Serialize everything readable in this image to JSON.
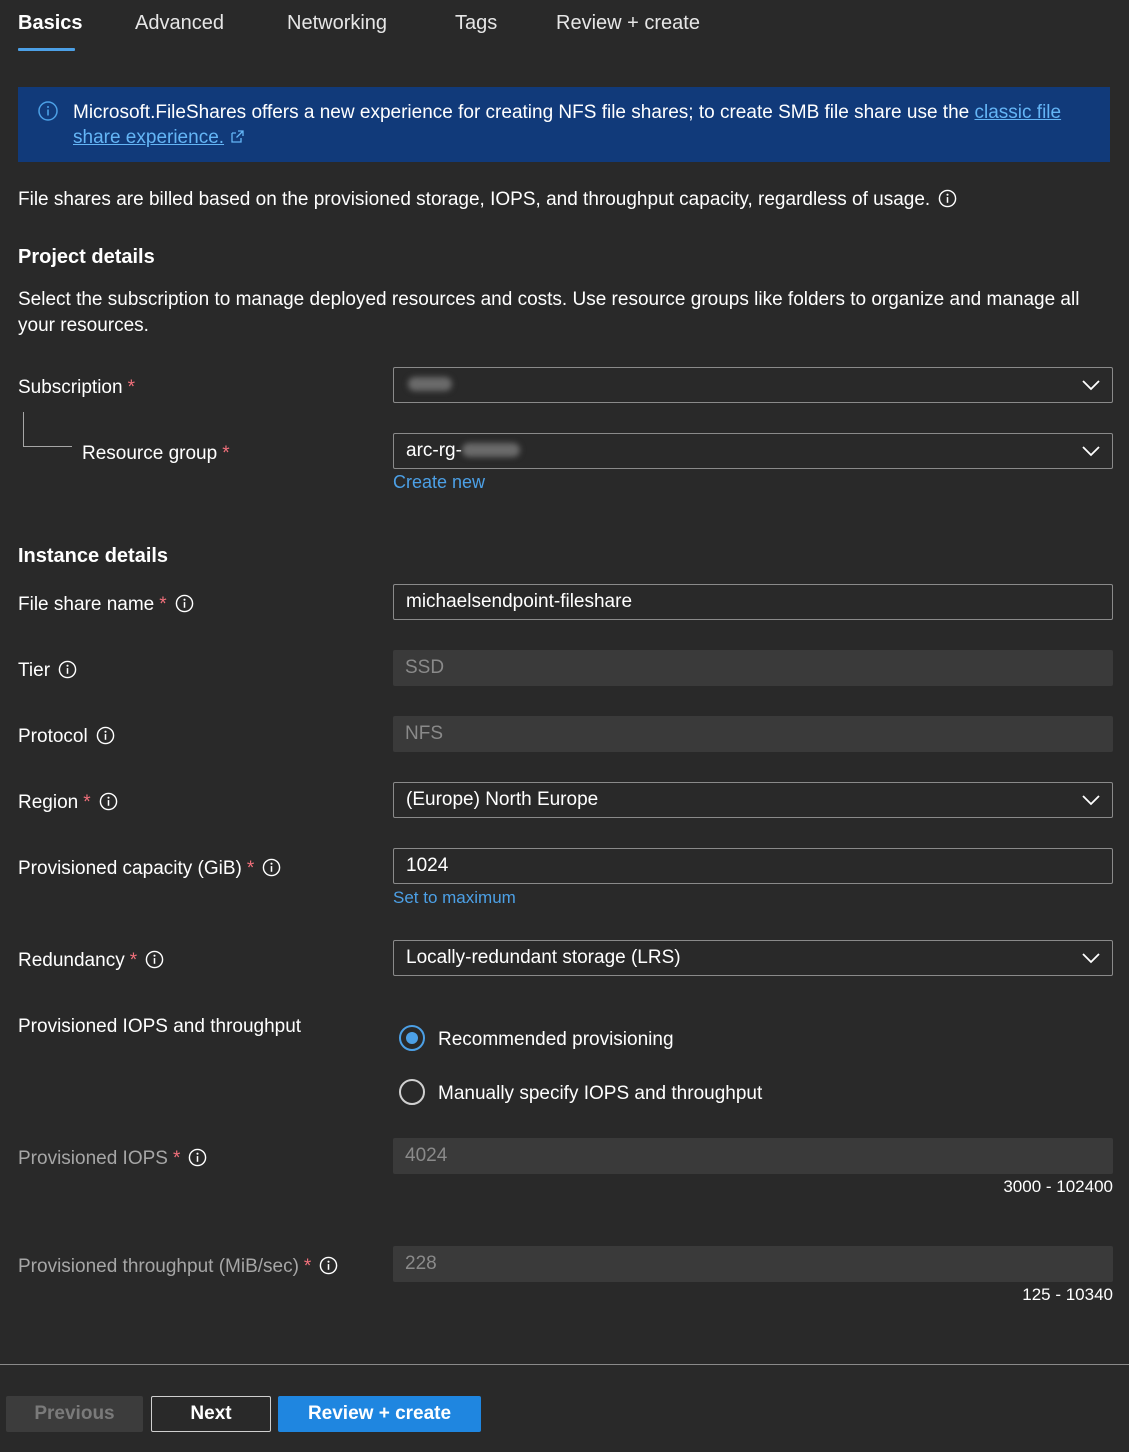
{
  "tabs": [
    {
      "label": "Basics",
      "active": true
    },
    {
      "label": "Advanced"
    },
    {
      "label": "Networking"
    },
    {
      "label": "Tags"
    },
    {
      "label": "Review + create"
    }
  ],
  "banner": {
    "text": "Microsoft.FileShares offers a new experience for creating NFS file shares; to create SMB file share use the ",
    "link_text": "classic file share experience."
  },
  "billing_note": "File shares are billed based on the provisioned storage, IOPS, and throughput capacity, regardless of usage.",
  "project_details": {
    "heading": "Project details",
    "description": "Select the subscription to manage deployed resources and costs. Use resource groups like folders to organize and manage all your resources.",
    "subscription_label": "Subscription",
    "resource_group_label": "Resource group",
    "resource_group_prefix": "arc-rg-",
    "create_new": "Create new"
  },
  "instance_details": {
    "heading": "Instance details",
    "file_share_name_label": "File share name",
    "file_share_name_value": "michaelsendpoint-fileshare",
    "tier_label": "Tier",
    "tier_value": "SSD",
    "protocol_label": "Protocol",
    "protocol_value": "NFS",
    "region_label": "Region",
    "region_value": "(Europe) North Europe",
    "capacity_label": "Provisioned capacity (GiB)",
    "capacity_value": "1024",
    "set_max": "Set to maximum",
    "redundancy_label": "Redundancy",
    "redundancy_value": "Locally-redundant storage (LRS)",
    "iops_throughput_label": "Provisioned IOPS and throughput",
    "radio_recommended": "Recommended provisioning",
    "radio_manual": "Manually specify IOPS and throughput",
    "iops_label": "Provisioned IOPS",
    "iops_value": "4024",
    "iops_range": "3000 - 102400",
    "throughput_label": "Provisioned throughput (MiB/sec)",
    "throughput_value": "228",
    "throughput_range": "125 - 10340"
  },
  "footer": {
    "previous": "Previous",
    "next": "Next",
    "review": "Review + create"
  },
  "colors": {
    "accent": "#4ca0e6",
    "required": "#f1707b",
    "banner_bg": "#113a7a",
    "primary_button": "#1f86e0"
  }
}
